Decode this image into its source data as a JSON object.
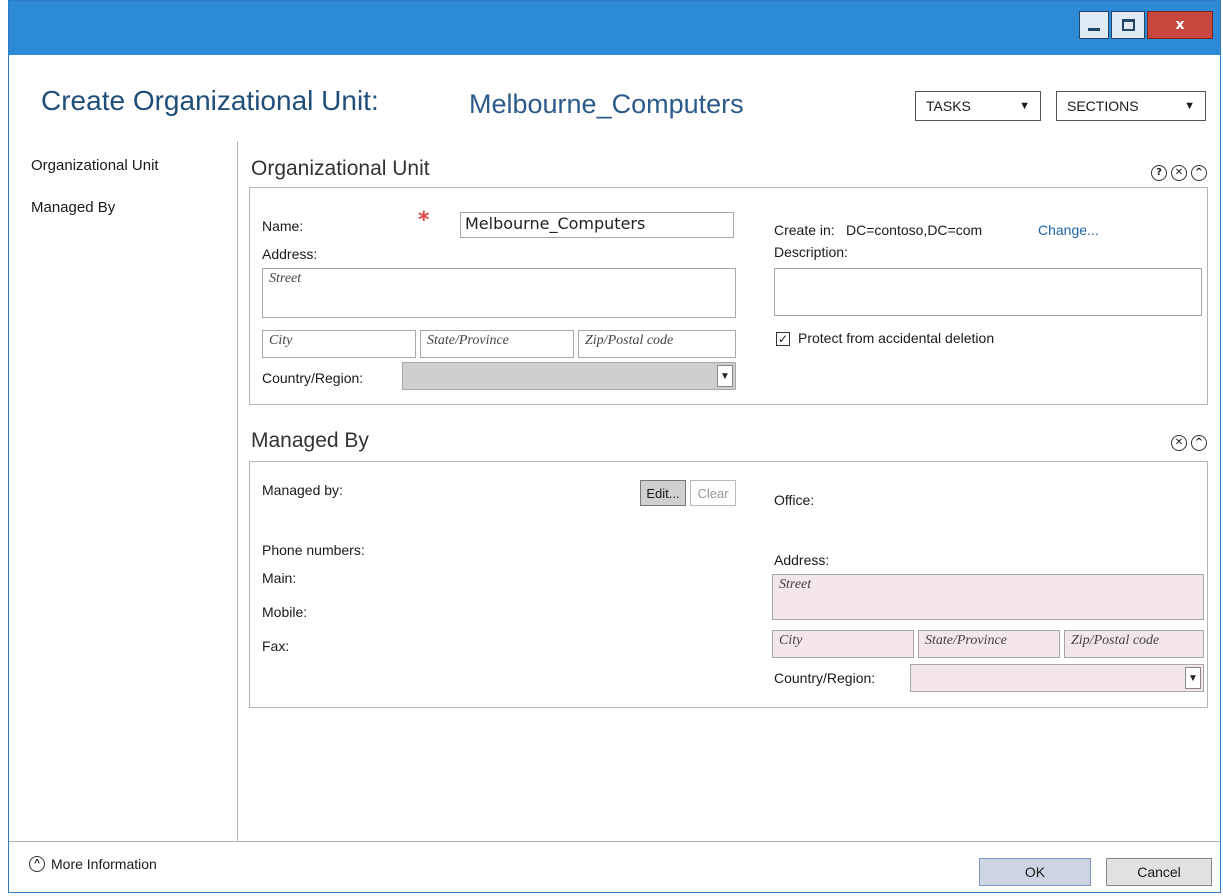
{
  "window": {
    "min_icon": "minimize-icon",
    "max_icon": "maximize-icon",
    "close_label": "x"
  },
  "header": {
    "title": "Create Organizational Unit:",
    "object_name": "Melbourne_Computers",
    "tasks_label": "TASKS",
    "sections_label": "SECTIONS",
    "dropdown_glyph": "▼"
  },
  "nav": {
    "items": [
      {
        "label": "Organizational Unit"
      },
      {
        "label": "Managed By"
      }
    ]
  },
  "ou_section": {
    "title": "Organizational Unit",
    "help_glyph": "?",
    "close_glyph": "✕",
    "collapse_glyph": "^",
    "name_label": "Name:",
    "name_value": "Melbourne_Computers",
    "address_label": "Address:",
    "street_placeholder": "Street",
    "city_placeholder": "City",
    "state_placeholder": "State/Province",
    "zip_placeholder": "Zip/Postal code",
    "country_label": "Country/Region:",
    "create_in_label": "Create in:",
    "create_in_value": "DC=contoso,DC=com",
    "change_link": "Change...",
    "description_label": "Description:",
    "protect_label": "Protect from accidental deletion",
    "protect_checked": true
  },
  "managed_section": {
    "title": "Managed By",
    "close_glyph": "✕",
    "collapse_glyph": "^",
    "managed_by_label": "Managed by:",
    "edit_label": "Edit...",
    "clear_label": "Clear",
    "office_label": "Office:",
    "phone_label": "Phone numbers:",
    "main_label": "Main:",
    "mobile_label": "Mobile:",
    "fax_label": "Fax:",
    "address_label": "Address:",
    "street_placeholder": "Street",
    "city_placeholder": "City",
    "state_placeholder": "State/Province",
    "zip_placeholder": "Zip/Postal code",
    "country_label": "Country/Region:"
  },
  "footer": {
    "more_info_label": "More Information",
    "ok_label": "OK",
    "cancel_label": "Cancel"
  },
  "colors": {
    "titlebar": "#2d8ad4",
    "required": "#e04040",
    "link": "#1f63a8"
  }
}
